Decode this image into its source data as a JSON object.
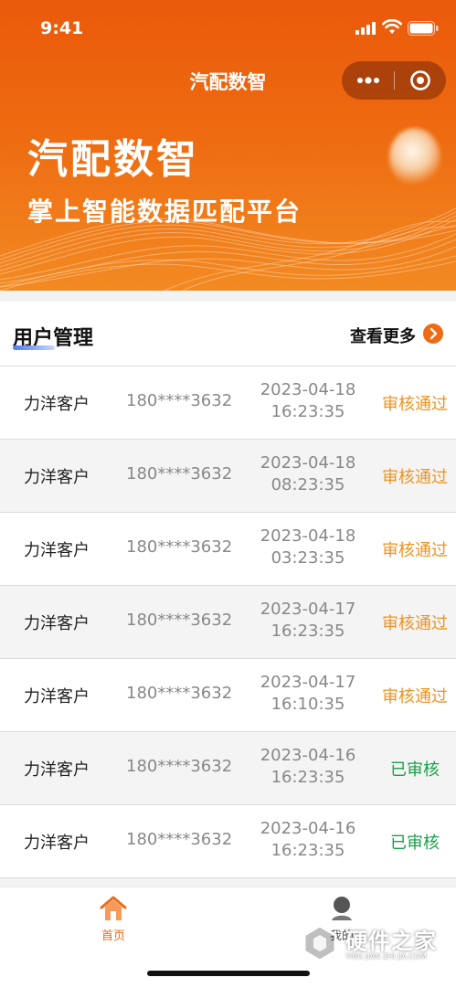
{
  "status_bar": {
    "time": "9:41"
  },
  "navbar": {
    "title": "汽配数智"
  },
  "hero": {
    "title": "汽配数智",
    "subtitle": "掌上智能数据匹配平台"
  },
  "section": {
    "title": "用户管理",
    "view_more": "查看更多"
  },
  "users": [
    {
      "name": "力洋客户",
      "phone": "180****3632",
      "date": "2023-04-18",
      "time": "16:23:35",
      "status": "审核通过",
      "status_type": "approved"
    },
    {
      "name": "力洋客户",
      "phone": "180****3632",
      "date": "2023-04-18",
      "time": "08:23:35",
      "status": "审核通过",
      "status_type": "approved"
    },
    {
      "name": "力洋客户",
      "phone": "180****3632",
      "date": "2023-04-18",
      "time": "03:23:35",
      "status": "审核通过",
      "status_type": "approved"
    },
    {
      "name": "力洋客户",
      "phone": "180****3632",
      "date": "2023-04-17",
      "time": "16:23:35",
      "status": "审核通过",
      "status_type": "approved"
    },
    {
      "name": "力洋客户",
      "phone": "180****3632",
      "date": "2023-04-17",
      "time": "16:10:35",
      "status": "审核通过",
      "status_type": "approved"
    },
    {
      "name": "力洋客户",
      "phone": "180****3632",
      "date": "2023-04-16",
      "time": "16:23:35",
      "status": "已审核",
      "status_type": "reviewed"
    },
    {
      "name": "力洋客户",
      "phone": "180****3632",
      "date": "2023-04-16",
      "time": "16:23:35",
      "status": "已审核",
      "status_type": "reviewed"
    }
  ],
  "tabbar": {
    "home_label": "首页",
    "mine_label": "我的"
  },
  "watermark": {
    "text": "硬件之家",
    "sub": "YING JIAN ZHI JIA.COM"
  },
  "colors": {
    "accent": "#ef6a12",
    "approved": "#f0921e",
    "reviewed": "#1aa148"
  }
}
